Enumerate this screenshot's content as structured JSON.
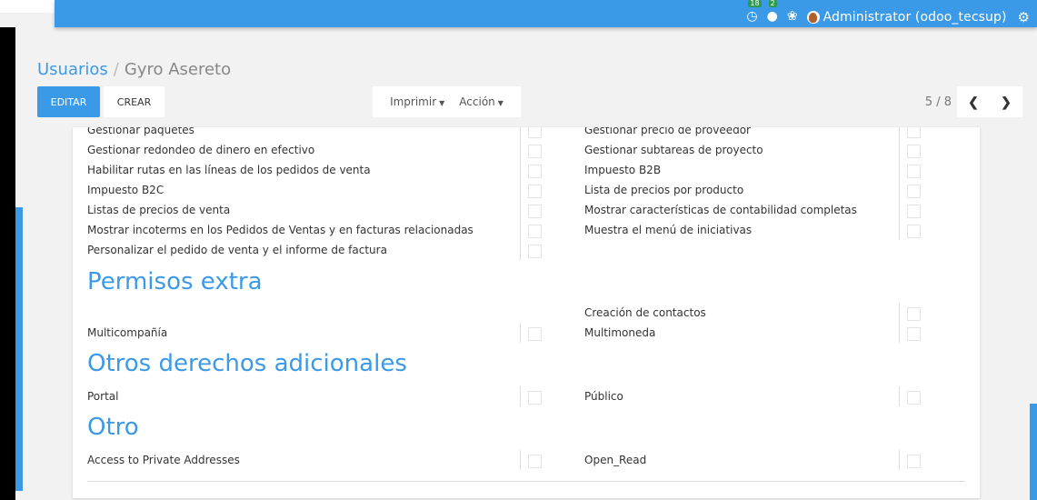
{
  "navbar": {
    "activity_badge": "18",
    "messages_badge": "2",
    "user_label": "Administrator (odoo_tecsup)"
  },
  "breadcrumb": {
    "parent": "Usuarios",
    "separator": "/",
    "current": "Gyro Asereto"
  },
  "toolbar": {
    "edit_label": "EDITAR",
    "create_label": "CREAR",
    "print_label": "Imprimir",
    "action_label": "Acción",
    "pager": "5 / 8"
  },
  "groups": {
    "left": [
      "Gestionar paquetes",
      "Gestionar redondeo de dinero en efectivo",
      "Habilitar rutas en las líneas de los pedidos de venta",
      "Impuesto B2C",
      "Listas de precios de venta",
      "Mostrar incoterms en los Pedidos de Ventas y en facturas relacionadas",
      "Personalizar el pedido de venta y el informe de factura"
    ],
    "right": [
      "Gestionar precio de proveedor",
      "Gestionar subtareas de proyecto",
      "Impuesto B2B",
      "Lista de precios por producto",
      "Mostrar características de contabilidad completas",
      "Muestra el menú de iniciativas"
    ]
  },
  "extra": {
    "title": "Permisos extra",
    "left": [
      "Multicompañía"
    ],
    "right": [
      "Creación de contactos",
      "Multimoneda"
    ]
  },
  "additional": {
    "title": "Otros derechos adicionales",
    "left": [
      "Portal"
    ],
    "right": [
      "Público"
    ]
  },
  "other": {
    "title": "Otro",
    "left": [
      "Access to Private Addresses"
    ],
    "right": [
      "Open_Read"
    ]
  }
}
